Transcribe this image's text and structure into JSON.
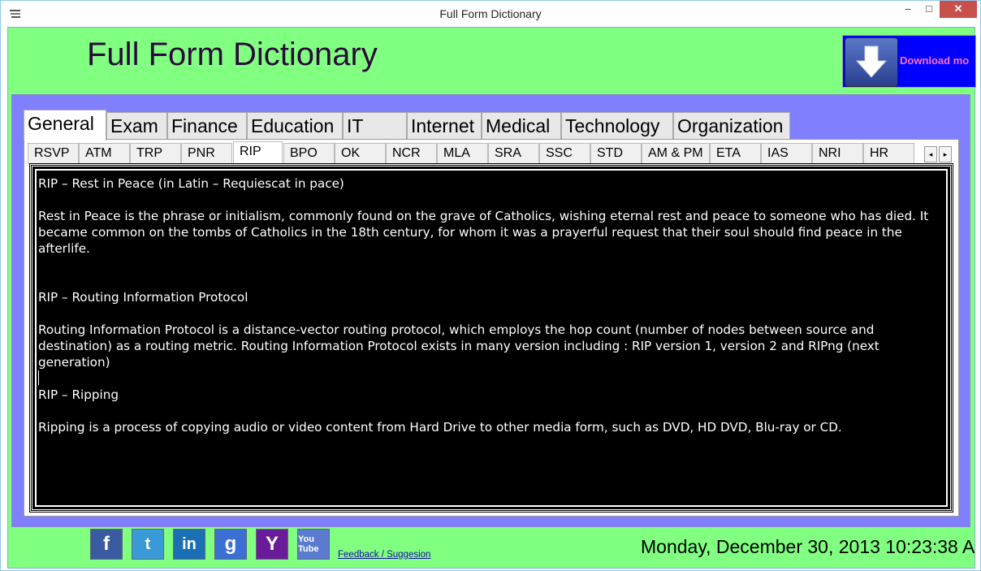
{
  "window": {
    "title": "Full Form Dictionary",
    "minimize": "–",
    "maximize": "□",
    "close": "✕"
  },
  "header": {
    "app_title": "Full Form Dictionary",
    "download_label": "Download mo"
  },
  "category_tabs": [
    "General",
    "Exam",
    "Finance",
    "Education",
    "IT",
    "Internet",
    "Medical",
    "Technology",
    "Organization"
  ],
  "active_category": "General",
  "sub_tabs": [
    "RSVP",
    "ATM",
    "TRP",
    "PNR",
    "RIP",
    "BPO",
    "OK",
    "NCR",
    "MLA",
    "SRA",
    "SSC",
    "STD",
    "AM & PM",
    "ETA",
    "IAS",
    "NRI",
    "HR"
  ],
  "active_sub_tab": "RIP",
  "scroll_buttons": {
    "left": "◂",
    "right": "▸"
  },
  "content": {
    "p1": "RIP – Rest in Peace (in Latin – Requiescat in pace)",
    "p2": "Rest in Peace is the phrase or initialism, commonly found on the grave of Catholics, wishing eternal rest and peace to someone who has died. It became common on the tombs of Catholics in the 18th century, for whom it was a prayerful request that their soul should find peace in the afterlife.",
    "p3": "RIP – Routing Information Protocol",
    "p4": "Routing Information Protocol is a distance-vector routing protocol, which employs the hop count (number of nodes between source and destination) as a routing metric. Routing Information Protocol exists in many version including : RIP version 1, version 2 and RIPng (next generation)",
    "p5": "RIP – Ripping",
    "p6": "Ripping is a process of copying audio or video content from Hard Drive to other media form, such as DVD, HD DVD, Blu-ray or CD."
  },
  "social": {
    "facebook": "f",
    "twitter": "t",
    "linkedin": "in",
    "google": "g",
    "yahoo": "Y",
    "youtube": "You Tube"
  },
  "footer": {
    "feedback_link": "Feedback / Suggesion",
    "datetime": "Monday, December 30, 2013 10:23:38 A"
  }
}
